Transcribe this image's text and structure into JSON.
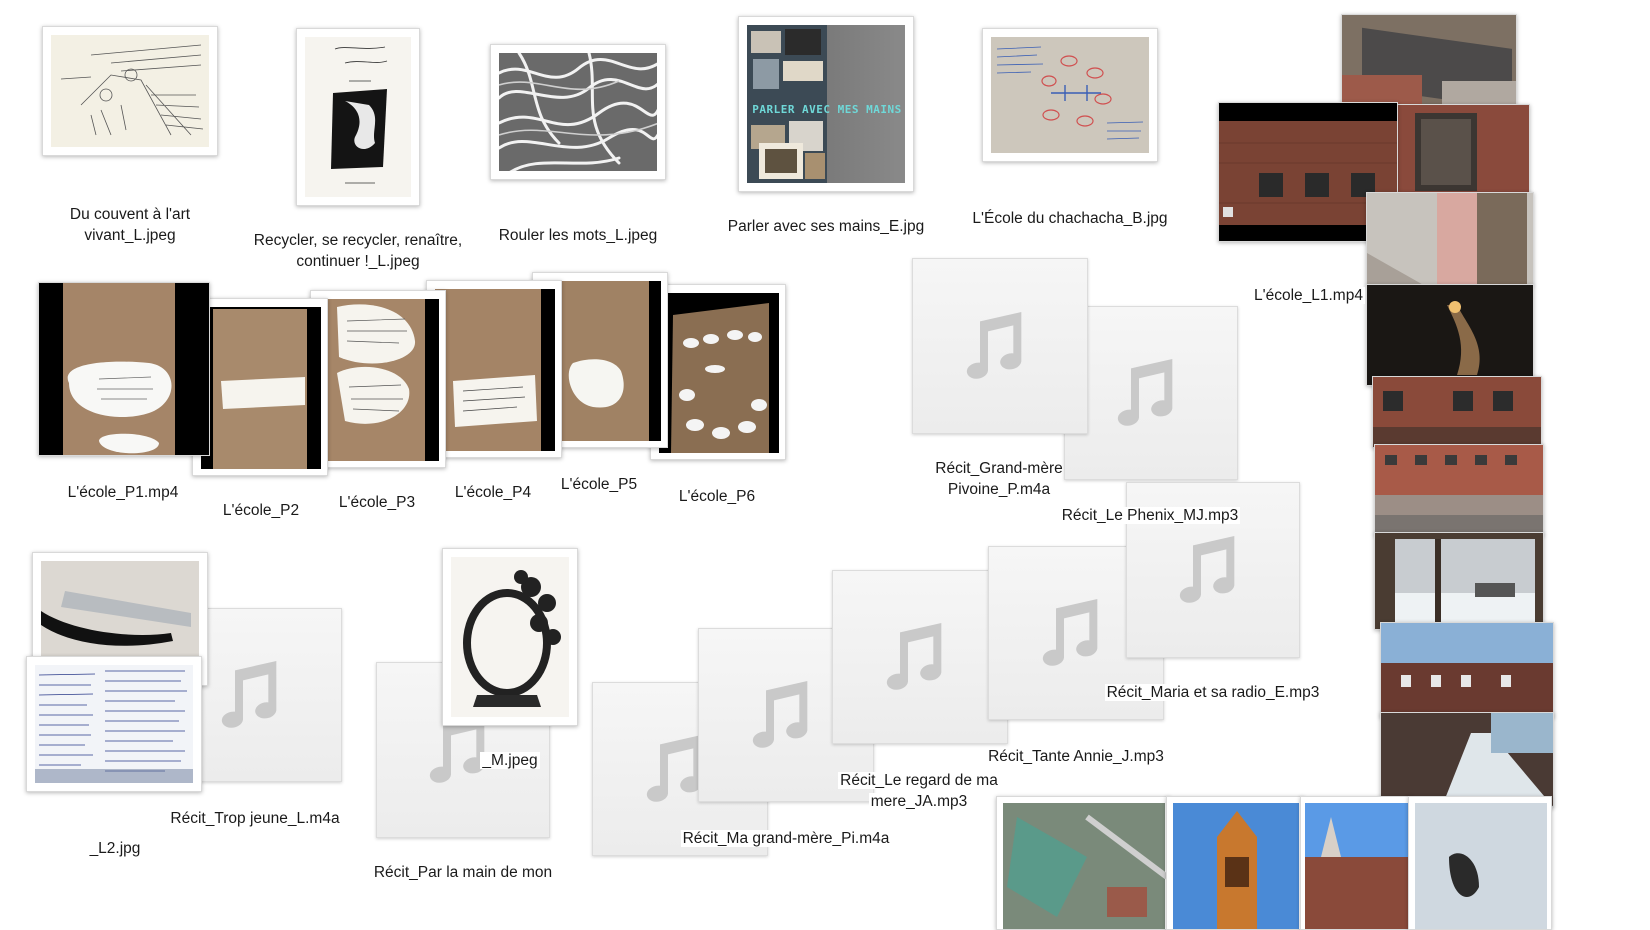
{
  "files": {
    "du_couvent": {
      "line1": "Du couvent à l'art",
      "line2": "vivant_L.jpeg"
    },
    "recycler": {
      "line1": "Recycler, se recycler, renaître,",
      "line2": "continuer !_L.jpeg"
    },
    "rouler": {
      "name": "Rouler les mots_L.jpeg"
    },
    "parler": {
      "name": "Parler avec ses mains_E.jpg",
      "cover_text": "PARLER AVEC MES MAINS"
    },
    "chachacha": {
      "name": "L'École du chachacha_B.jpg"
    },
    "ecole_l1": {
      "name": "L'école_L1.mp4"
    },
    "ecole_p1": {
      "name": "L'école_P1.mp4"
    },
    "ecole_p2": {
      "name": "L'école_P2"
    },
    "ecole_p3": {
      "name": "L'école_P3"
    },
    "ecole_p4": {
      "name": "L'école_P4"
    },
    "ecole_p5": {
      "name": "L'école_P5"
    },
    "ecole_p6": {
      "name": "L'école_P6"
    },
    "grand_mere_pivoine": {
      "line1": "Récit_Grand-mère",
      "line2": "Pivoine_P.m4a"
    },
    "le_phenix": {
      "name": "Récit_Le Phenix_MJ.mp3"
    },
    "maria": {
      "name": "Récit_Maria et sa radio_E.mp3"
    },
    "tante_annie": {
      "name": "Récit_Tante Annie_J.mp3"
    },
    "regard_mere": {
      "line1": "Récit_Le regard de ma",
      "line2": "mere_JA.mp3"
    },
    "ma_grand_mere": {
      "name": "Récit_Ma grand-mère_Pi.m4a"
    },
    "trop_jeune": {
      "name": "Récit_Trop jeune_L.m4a"
    },
    "l2": {
      "name": "_L2.jpg"
    },
    "m_jpeg": {
      "name": "_M.jpeg"
    },
    "par_la_main": {
      "name": "Récit_Par la main de mon"
    }
  },
  "icons": {
    "audio": "music-note-icon"
  },
  "colors": {
    "background": "#ffffff",
    "audio_tile": "#efefef",
    "note": "#c8c8c8",
    "label": "#1a1a1a"
  }
}
